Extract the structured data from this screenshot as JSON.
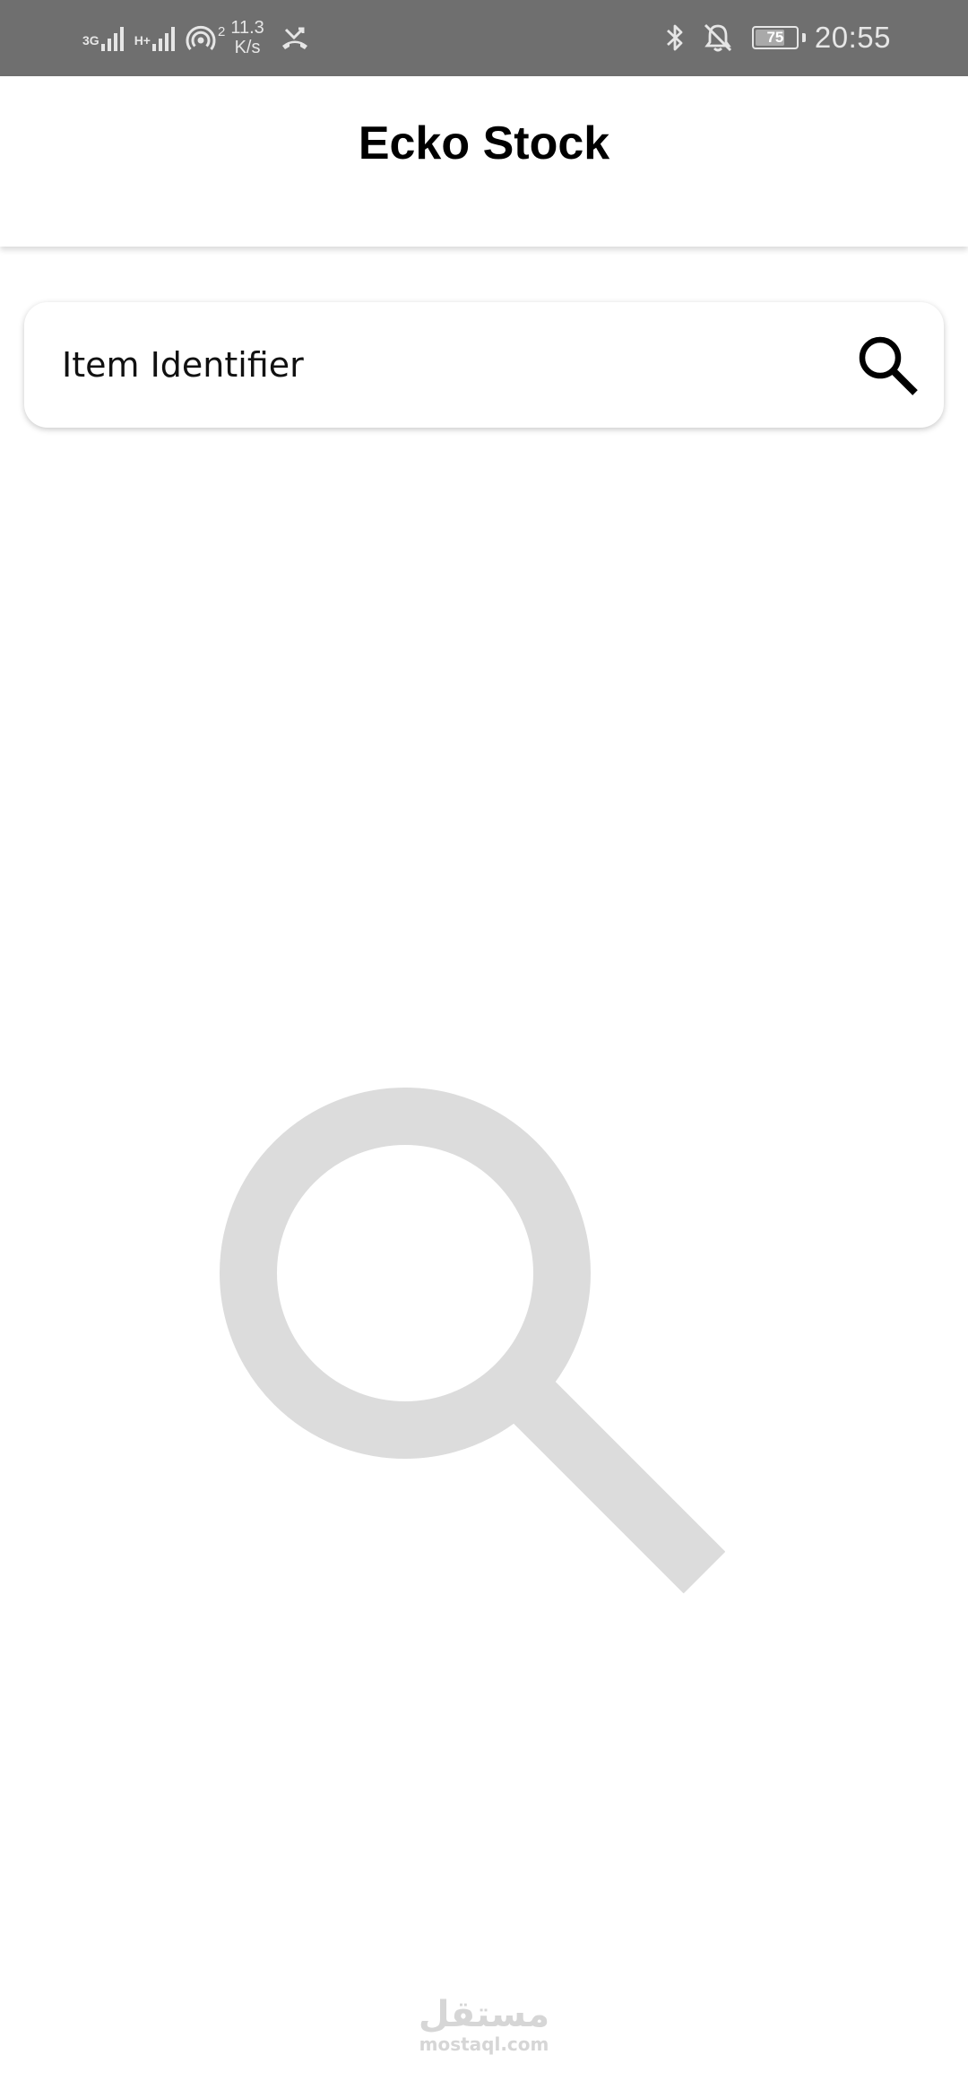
{
  "status_bar": {
    "sim1_tag": "3G",
    "sim2_tag": "H+",
    "hotspot_devices": "2",
    "speed_value": "11.3",
    "speed_unit": "K/s",
    "battery_percent": "75",
    "battery_level": 0.75,
    "time": "20:55",
    "icons": [
      "signal-icon",
      "signal-icon",
      "hotspot-icon",
      "missed-call-icon",
      "bluetooth-icon",
      "notifications-off-icon",
      "battery-icon"
    ]
  },
  "app_bar": {
    "title": "Ecko Stock"
  },
  "search": {
    "placeholder": "Item Identifier",
    "value": "",
    "icon": "search-icon"
  },
  "empty_state": {
    "icon": "search-icon",
    "color": "#dcdcdc"
  },
  "watermark": {
    "arabic": "مستقل",
    "latin": "mostaql.com"
  },
  "colors": {
    "status_bar_bg": "#6f6f6f",
    "app_bar_bg": "#ffffff",
    "title_color": "#000000",
    "page_bg": "#ffffff"
  }
}
